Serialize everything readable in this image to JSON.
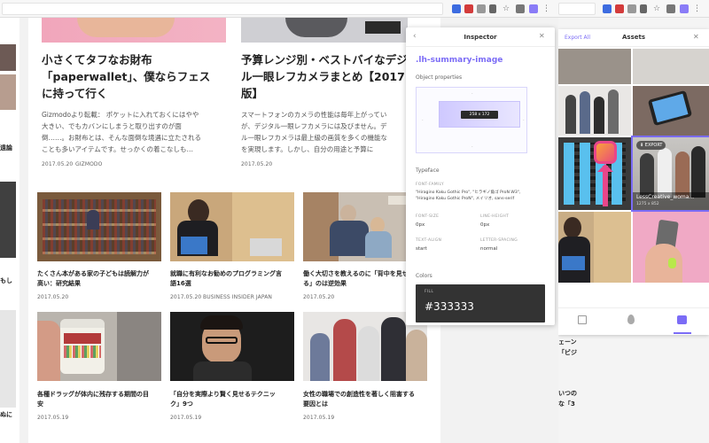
{
  "left_window": {
    "articles_top": [
      {
        "title": "小さくてタフなお財布「paperwallet」、僕ならフェスに持って行く",
        "title_lines": [
          "小さくてタフなお財布",
          "「paperwallet」、僕ならフェス",
          "に持って行く"
        ],
        "excerpt_lines": [
          "Gizmodoより転載： ポケットに入れておくにはやや",
          "大きい、でもカバンにしまうと取り出すのが面",
          "倒……。お財布とは、そんな面倒な境遇に立たされる",
          "ことも多いアイテムです。せっかくの着こなしも…"
        ],
        "date": "2017.05.20",
        "source": "GIZMODO"
      },
      {
        "title": "予算レンジ別・ベストバイなデジタル一眼レフカメラまとめ【2017年版】",
        "title_lines": [
          "予算レンジ別・ベストバイなデジタ",
          "ル一眼レフカメラまとめ【2017",
          "版】"
        ],
        "excerpt_lines": [
          "スマートフォンのカメラの性能は毎年上がってい",
          "が、デジタル一眼レフカメラには及びません。デ",
          "ル一眼レフカメラは最上級の画質を多くの機能な",
          "を実現します。しかし、自分の用途と予算に"
        ],
        "date": "2017.05.20"
      }
    ],
    "articles_grid": [
      {
        "title_lines": [
          "たくさん本がある家の子どもは読解力が",
          "高い：研究結果"
        ],
        "date": "2017.05.20",
        "source": ""
      },
      {
        "title_lines": [
          "就職に有利なお勧めのプログラミング言",
          "語16選"
        ],
        "date": "2017.05.20",
        "source": "BUSINESS INSIDER JAPAN"
      },
      {
        "title_lines": [
          "働く大切さを教えるのに「背中を見せ",
          "る」のは逆効果"
        ],
        "date": "2017.05.20",
        "source": ""
      },
      {
        "title_lines": [
          "各種ドラッグが体内に残存する期間の目",
          "安"
        ],
        "date": "2017.05.19",
        "source": ""
      },
      {
        "title_lines": [
          "「自分を実際より賢く見せるテクニッ",
          "ク」9つ"
        ],
        "date": "2017.05.19",
        "source": ""
      },
      {
        "title_lines": [
          "女性の職場での創造性を著しく阻害する",
          "要因とは"
        ],
        "date": "2017.05.19",
        "source": ""
      }
    ],
    "sidebar_snippets": [
      "遠論",
      "もし",
      "ぬに"
    ]
  },
  "inspector": {
    "title": "Inspector",
    "back_icon": "chevron-left-icon",
    "close_icon": "close-icon",
    "selector": ".lh-summary-image",
    "object_properties_label": "Object properties",
    "size_badge": "258 x 172",
    "typeface_label": "Typeface",
    "font_family_label": "FONT-FAMILY",
    "font_family_value_lines": [
      "\"Hiragino Kaku Gothic Pro\", \"ヒラギノ角ゴ ProN W3\",",
      "\"Hiragino Kaku Gothic ProN\", メイリオ, sans-serif"
    ],
    "font_size_label": "FONT-SIZE",
    "font_size_value": "0px",
    "line_height_label": "LINE-HEIGHT",
    "line_height_value": "0px",
    "text_align_label": "TEXT-ALIGN",
    "text_align_value": "start",
    "letter_spacing_label": "LETTER-SPACING",
    "letter_spacing_value": "normal",
    "colors_label": "Colors",
    "fill_label": "FILL",
    "fill_value": "#333333",
    "accent": "#7b6cf6"
  },
  "assets_panel": {
    "export_all": "Export All",
    "title": "Assets",
    "close_icon": "close-icon",
    "export_badge": "EXPORT",
    "highlight_caption": "LessCreative_woma...",
    "highlight_sub": "1275 x 852",
    "footer_icons": [
      "layout-icon",
      "drop-icon",
      "assets-icon"
    ],
    "bg_snippets": [
      "ェーン",
      "「ビジ",
      "いつの",
      "な「3"
    ]
  }
}
